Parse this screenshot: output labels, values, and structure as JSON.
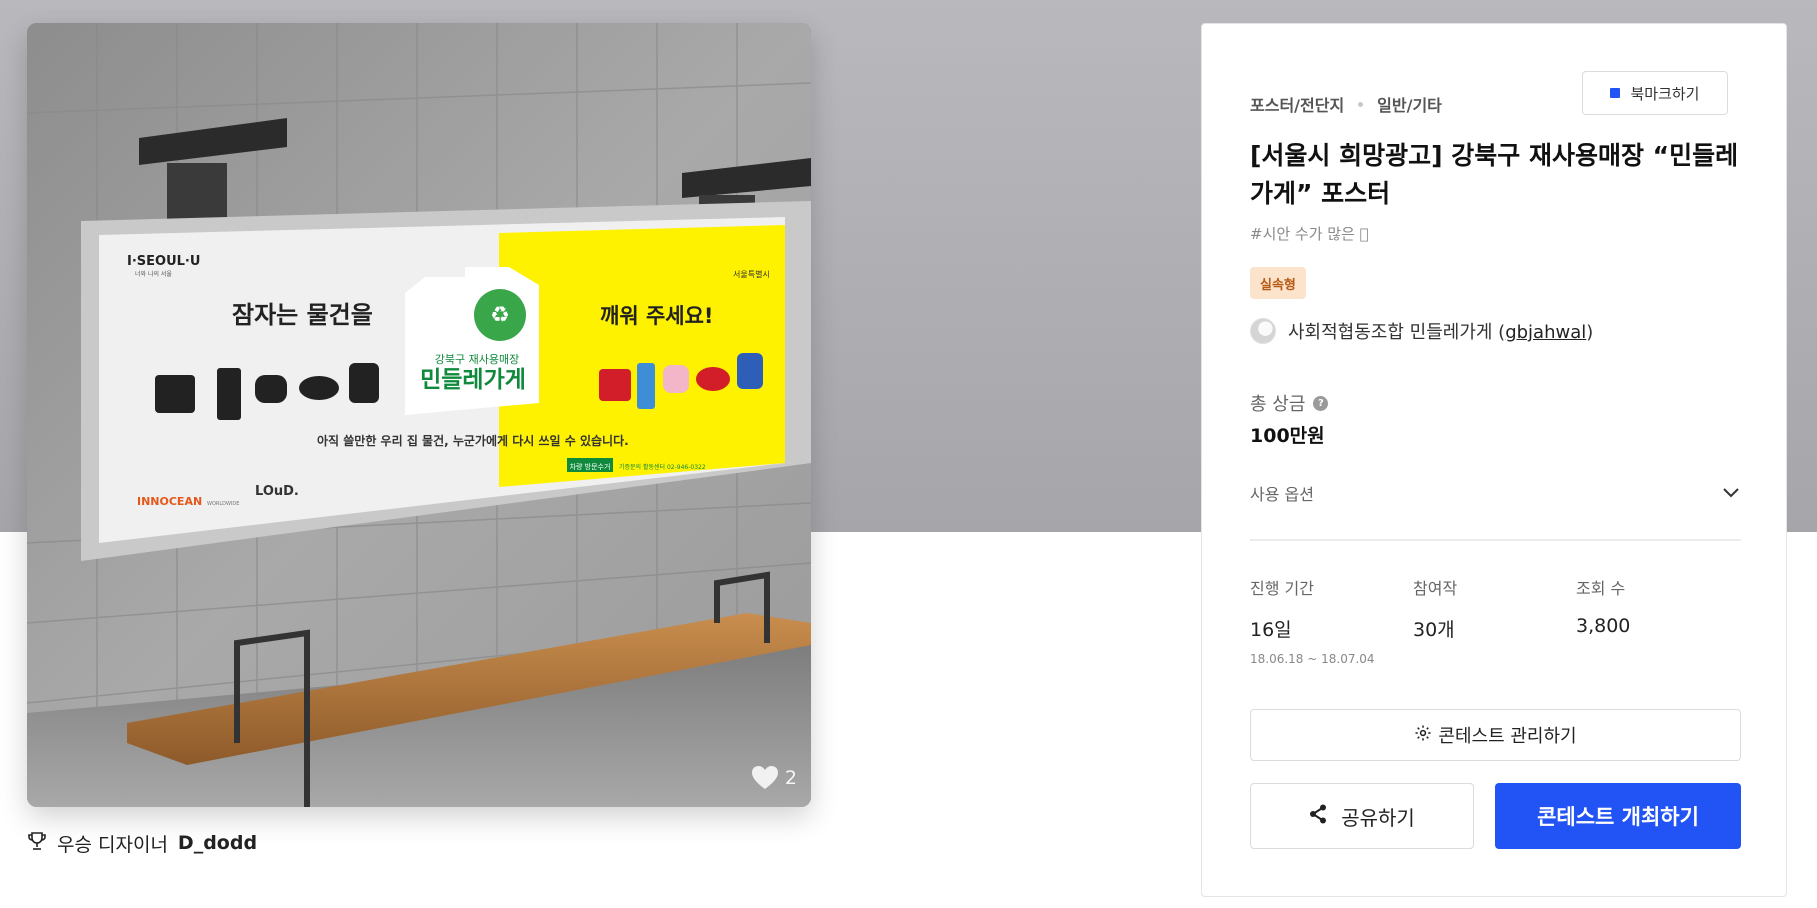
{
  "contest_image": {
    "alt": "",
    "poster": {
      "logo_left": "I·SEOUL·U",
      "logo_left_sub": "너와 나의 서울",
      "logo_right": "서울특별시",
      "headline_left": "잠자는 물건을",
      "headline_right": "깨워 주세요!",
      "store_sub": "강북구 재사용매장",
      "store_name": "민들레가게",
      "body": "아직 쓸만한 우리 집 물건, 누군가에게 다시 쓰일 수 있습니다.",
      "tag": "차량 방문수거",
      "contact": "기증문의 활동센터 02-946-0322",
      "sponsor_1": "INNOCEAN",
      "sponsor_1_sub": "WORLDWIDE",
      "sponsor_2": "LOuD."
    },
    "like_count": "2"
  },
  "winner": {
    "label": "우승 디자이너",
    "name": "D_dodd"
  },
  "panel": {
    "categories": [
      "포스터/전단지",
      "일반/기타"
    ],
    "bookmark_label": "북마크하기",
    "title": "[서울시 희망광고] 강북구 재사용매장 “민들레가게” 포스터",
    "hashtag": "#시안 수가 많은 🏻",
    "badge": "실속형",
    "host_name": "사회적협동조합 민들레가게",
    "host_username": "gbjahwal",
    "prize_label": "총 상금",
    "prize_value": "100만원",
    "options_label": "사용 옵션",
    "stats": [
      {
        "label": "진행 기간",
        "value": "16일",
        "sub": "18.06.18 ~ 18.07.04"
      },
      {
        "label": "참여작",
        "value": "30개",
        "sub": ""
      },
      {
        "label": "조회 수",
        "value": "3,800",
        "sub": ""
      }
    ],
    "manage_label": "콘테스트 관리하기",
    "share_label": "공유하기",
    "host_contest_label": "콘테스트 개최하기"
  },
  "colors": {
    "accent": "#2253f5",
    "badge_bg": "#fbe3cc",
    "badge_text": "#b85a14",
    "poster_yellow": "#fff200",
    "poster_green": "#0f8a3c"
  },
  "icons": [
    "heart-icon",
    "trophy-icon",
    "bookmark-icon",
    "help-icon",
    "chevron-down-icon",
    "gear-icon",
    "share-icon"
  ]
}
